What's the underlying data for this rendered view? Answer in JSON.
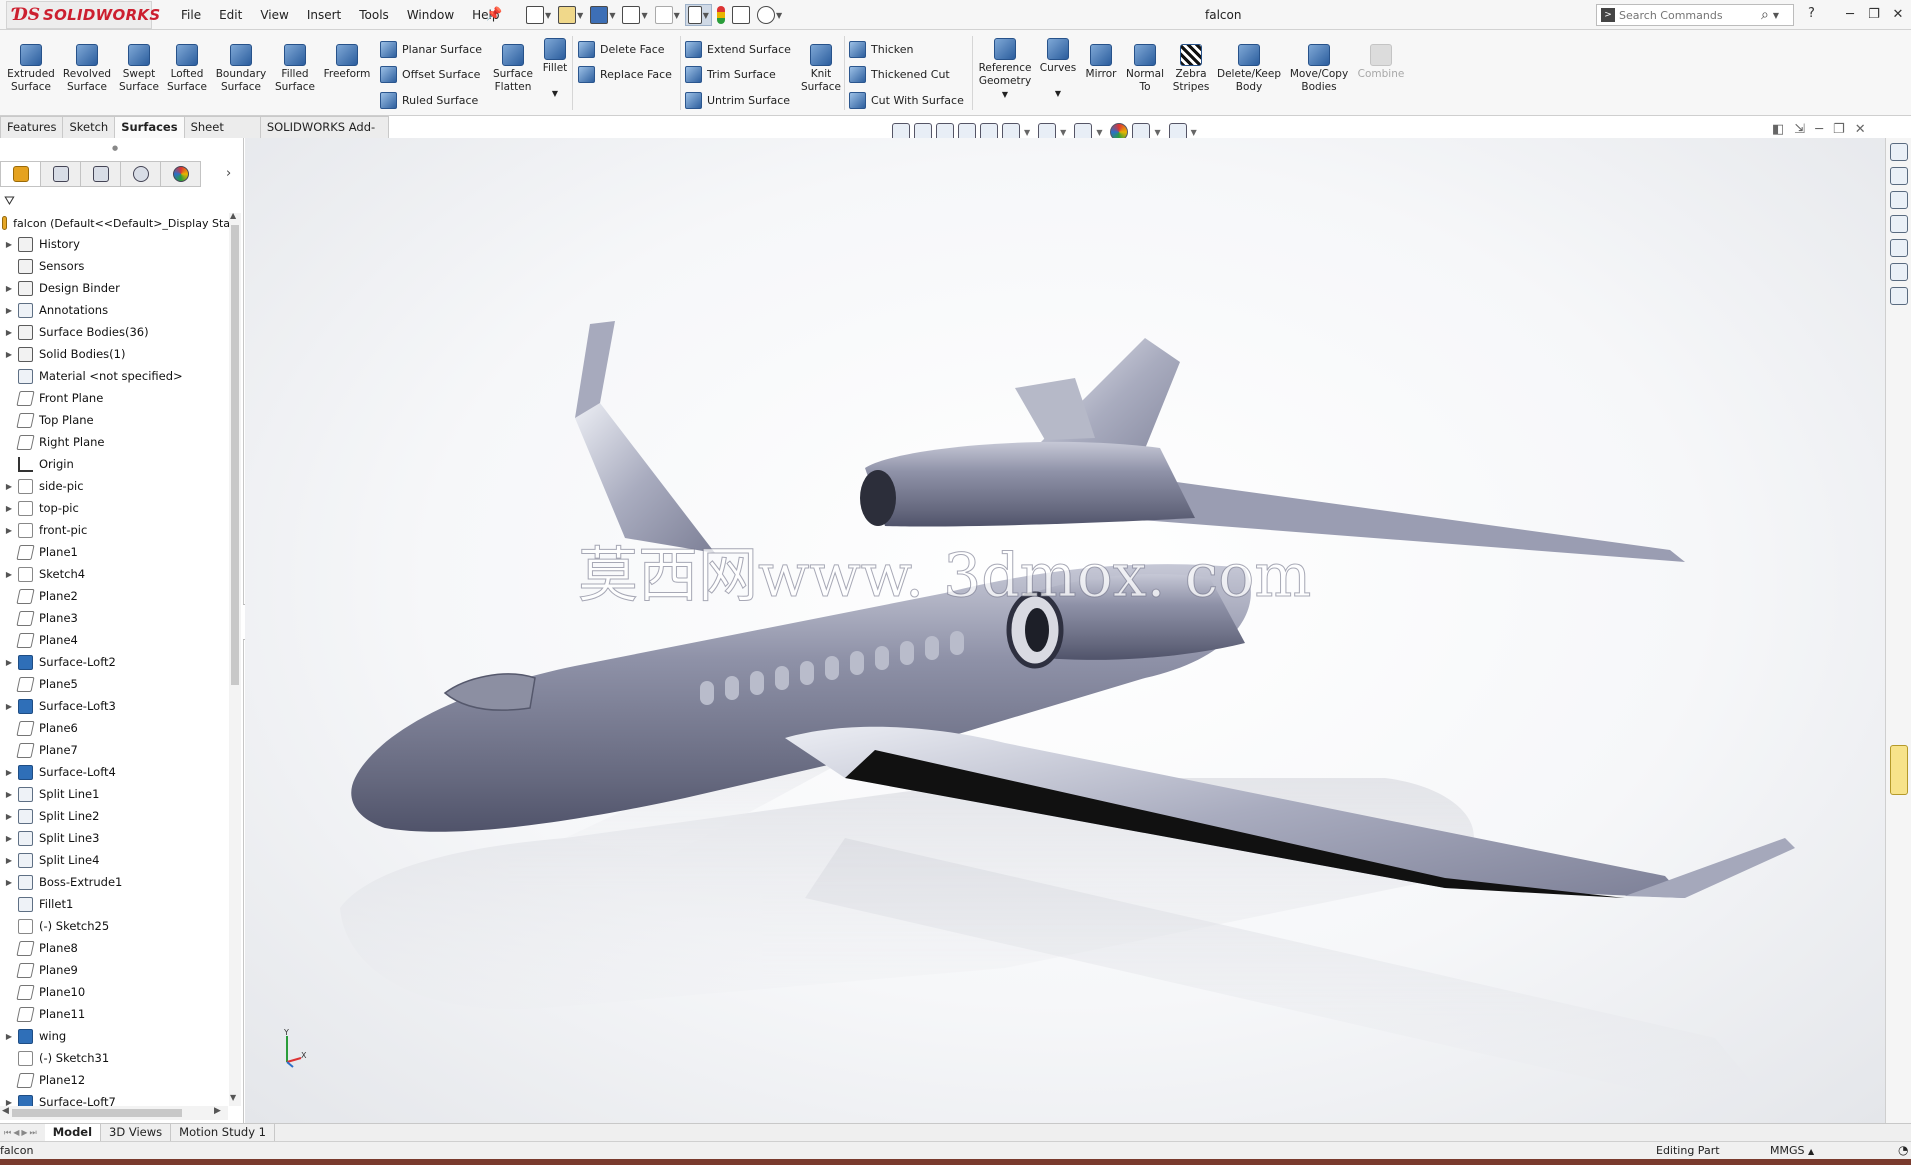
{
  "app": {
    "logo_ds": "ƊS",
    "logo_text": "SOLIDWORKS",
    "window_title": "falcon",
    "menu": [
      "File",
      "Edit",
      "View",
      "Insert",
      "Tools",
      "Window",
      "Help"
    ],
    "search_placeholder": "Search Commands",
    "help": "?"
  },
  "ribbon": {
    "extruded": [
      "Extruded",
      "Surface"
    ],
    "revolved": [
      "Revolved",
      "Surface"
    ],
    "swept": [
      "Swept",
      "Surface"
    ],
    "lofted": [
      "Lofted",
      "Surface"
    ],
    "boundary": [
      "Boundary",
      "Surface"
    ],
    "filled": [
      "Filled",
      "Surface"
    ],
    "freeform": [
      "Freeform",
      ""
    ],
    "planar": "Planar Surface",
    "offset": "Offset Surface",
    "ruled": "Ruled Surface",
    "flatten": [
      "Surface",
      "Flatten"
    ],
    "fillet": "Fillet",
    "delete_face": "Delete Face",
    "replace_face": "Replace Face",
    "extend": "Extend Surface",
    "trim": "Trim Surface",
    "untrim": "Untrim Surface",
    "knit": [
      "Knit",
      "Surface"
    ],
    "thicken": "Thicken",
    "thickened_cut": "Thickened Cut",
    "cut_with_surface": "Cut With Surface",
    "reference": [
      "Reference",
      "Geometry"
    ],
    "curves": "Curves",
    "mirror": "Mirror",
    "normal_to": [
      "Normal",
      "To"
    ],
    "zebra": [
      "Zebra",
      "Stripes"
    ],
    "delete_keep": [
      "Delete/Keep",
      "Body"
    ],
    "move_copy": [
      "Move/Copy",
      "Bodies"
    ],
    "combine": "Combine"
  },
  "tabs": [
    "Features",
    "Sketch",
    "Surfaces",
    "Sheet Metal",
    "SOLIDWORKS Add-Ins"
  ],
  "tree": {
    "root": "falcon  (Default<<Default>_Display Sta",
    "items": [
      {
        "label": "History",
        "icon": "folder-icon",
        "expand": true
      },
      {
        "label": "Sensors",
        "icon": "folder-icon",
        "expand": false
      },
      {
        "label": "Design Binder",
        "icon": "folder-icon",
        "expand": true
      },
      {
        "label": "Annotations",
        "icon": "annotations-icon",
        "expand": true
      },
      {
        "label": "Surface Bodies(36)",
        "icon": "folder-icon",
        "expand": true
      },
      {
        "label": "Solid Bodies(1)",
        "icon": "folder-icon",
        "expand": true
      },
      {
        "label": "Material <not specified>",
        "icon": "material-icon",
        "expand": false
      },
      {
        "label": "Front Plane",
        "icon": "plane-icon",
        "expand": false
      },
      {
        "label": "Top Plane",
        "icon": "plane-icon",
        "expand": false
      },
      {
        "label": "Right Plane",
        "icon": "plane-icon",
        "expand": false
      },
      {
        "label": "Origin",
        "icon": "origin-icon",
        "expand": false
      },
      {
        "label": "side-pic",
        "icon": "sketch-icon",
        "expand": true
      },
      {
        "label": "top-pic",
        "icon": "sketch-icon",
        "expand": true
      },
      {
        "label": "front-pic",
        "icon": "sketch-icon",
        "expand": true
      },
      {
        "label": "Plane1",
        "icon": "plane-icon",
        "expand": false
      },
      {
        "label": "Sketch4",
        "icon": "sketch-icon",
        "expand": true
      },
      {
        "label": "Plane2",
        "icon": "plane-icon",
        "expand": false
      },
      {
        "label": "Plane3",
        "icon": "plane-icon",
        "expand": false
      },
      {
        "label": "Plane4",
        "icon": "plane-icon",
        "expand": false
      },
      {
        "label": "Surface-Loft2",
        "icon": "feature-icon",
        "expand": true
      },
      {
        "label": "Plane5",
        "icon": "plane-icon",
        "expand": false
      },
      {
        "label": "Surface-Loft3",
        "icon": "feature-icon",
        "expand": true
      },
      {
        "label": "Plane6",
        "icon": "plane-icon",
        "expand": false
      },
      {
        "label": "Plane7",
        "icon": "plane-icon",
        "expand": false
      },
      {
        "label": "Surface-Loft4",
        "icon": "feature-icon",
        "expand": true
      },
      {
        "label": "Split Line1",
        "icon": "splitline-icon",
        "expand": true
      },
      {
        "label": "Split Line2",
        "icon": "splitline-icon",
        "expand": true
      },
      {
        "label": "Split Line3",
        "icon": "splitline-icon",
        "expand": true
      },
      {
        "label": "Split Line4",
        "icon": "splitline-icon",
        "expand": true
      },
      {
        "label": "Boss-Extrude1",
        "icon": "extrude-icon",
        "expand": true
      },
      {
        "label": "Fillet1",
        "icon": "fillet-icon",
        "expand": false
      },
      {
        "label": "(-) Sketch25",
        "icon": "sketch-icon",
        "expand": false
      },
      {
        "label": "Plane8",
        "icon": "plane-icon",
        "expand": false
      },
      {
        "label": "Plane9",
        "icon": "plane-icon",
        "expand": false
      },
      {
        "label": "Plane10",
        "icon": "plane-icon",
        "expand": false
      },
      {
        "label": "Plane11",
        "icon": "plane-icon",
        "expand": false
      },
      {
        "label": "wing",
        "icon": "feature-icon",
        "expand": true
      },
      {
        "label": "(-) Sketch31",
        "icon": "sketch-icon",
        "expand": false
      },
      {
        "label": "Plane12",
        "icon": "plane-icon",
        "expand": false
      },
      {
        "label": "Surface-Loft7",
        "icon": "feature-icon",
        "expand": true
      }
    ]
  },
  "watermark": "莫西网www. 3dmox. com",
  "triad": {
    "y": "Y",
    "x": "X"
  },
  "bottom_tabs": [
    "Model",
    "3D Views",
    "Motion Study 1"
  ],
  "status": {
    "left": "falcon",
    "editing": "Editing Part",
    "units": "MMGS"
  }
}
